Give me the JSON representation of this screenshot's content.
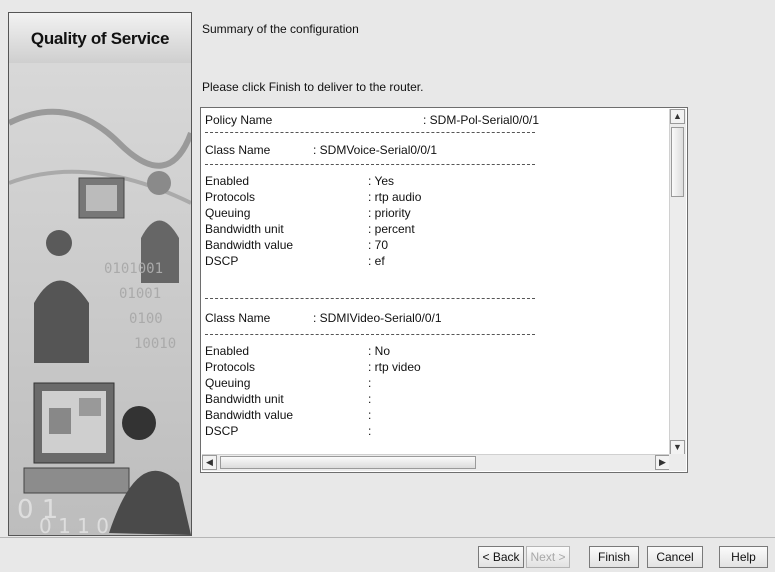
{
  "sidebar": {
    "title": "Quality of Service"
  },
  "intro": {
    "summary": "Summary of the configuration",
    "instruction": "Please click Finish to deliver to the router."
  },
  "summary_box": {
    "policy_label": "Policy Name",
    "policy_value": ": SDM-Pol-Serial0/0/1",
    "classes": [
      {
        "class_label": "Class Name",
        "class_value": ": SDMVoice-Serial0/0/1",
        "fields": [
          {
            "label": "Enabled",
            "value": ": Yes"
          },
          {
            "label": "Protocols",
            "value": ": rtp audio"
          },
          {
            "label": "Queuing",
            "value": ": priority"
          },
          {
            "label": "Bandwidth unit",
            "value": ": percent"
          },
          {
            "label": "Bandwidth value",
            "value": ": 70"
          },
          {
            "label": "DSCP",
            "value": ": ef"
          }
        ]
      },
      {
        "class_label": "Class Name",
        "class_value": ": SDMIVideo-Serial0/0/1",
        "fields": [
          {
            "label": "Enabled",
            "value": ": No"
          },
          {
            "label": "Protocols",
            "value": ": rtp video"
          },
          {
            "label": "Queuing",
            "value": ":"
          },
          {
            "label": "Bandwidth unit",
            "value": ":"
          },
          {
            "label": "Bandwidth value",
            "value": ":"
          },
          {
            "label": "DSCP",
            "value": ":"
          }
        ]
      }
    ]
  },
  "buttons": {
    "back": "< Back",
    "next": "Next >",
    "finish": "Finish",
    "cancel": "Cancel",
    "help": "Help"
  }
}
